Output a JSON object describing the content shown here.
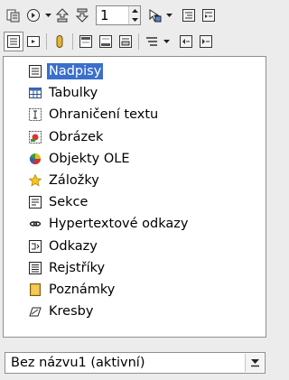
{
  "toolbar": {
    "heading_level": "1"
  },
  "navigator": {
    "items": [
      {
        "label": "Nadpisy",
        "icon": "headings-icon"
      },
      {
        "label": "Tabulky",
        "icon": "table-icon"
      },
      {
        "label": "Ohraničení textu",
        "icon": "text-frame-icon"
      },
      {
        "label": "Obrázek",
        "icon": "image-icon"
      },
      {
        "label": "Objekty OLE",
        "icon": "ole-object-icon"
      },
      {
        "label": "Záložky",
        "icon": "bookmark-star-icon"
      },
      {
        "label": "Sekce",
        "icon": "section-icon"
      },
      {
        "label": "Hypertextové odkazy",
        "icon": "hyperlink-icon"
      },
      {
        "label": "Odkazy",
        "icon": "reference-icon"
      },
      {
        "label": "Rejstříky",
        "icon": "index-icon"
      },
      {
        "label": "Poznámky",
        "icon": "note-icon"
      },
      {
        "label": "Kresby",
        "icon": "drawing-icon"
      }
    ],
    "selected_index": 0
  },
  "document_selector": {
    "value": "Bez názvu1 (aktivní)"
  },
  "colors": {
    "selection": "#3a6fcc",
    "panel_background": "#ececec"
  }
}
